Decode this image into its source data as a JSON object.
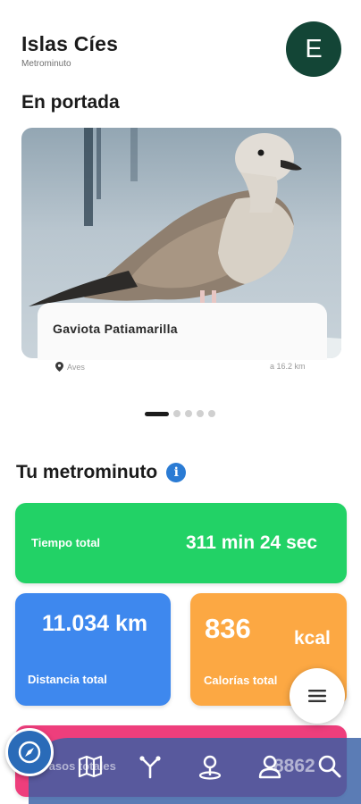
{
  "header": {
    "title": "Islas Cíes",
    "subtitle": "Metrominuto",
    "avatar_initial": "E"
  },
  "featured": {
    "section_title": "En portada",
    "item_name": "Gaviota Patiamarilla",
    "category": "Aves",
    "distance": "a 16.2 km",
    "carousel_total": 5,
    "carousel_active": 1
  },
  "metrominuto": {
    "title": "Tu metrominuto",
    "time": {
      "label": "Tiempo total",
      "value": "311 min 24 sec"
    },
    "distance": {
      "label": "Distancia total",
      "value": "11.034 km"
    },
    "calories": {
      "label": "Calorías total",
      "value": "836",
      "unit": "kcal"
    },
    "steps": {
      "label": "Pasos totales",
      "value": "8862"
    }
  },
  "nav": {
    "items": [
      "compass-icon",
      "map-icon",
      "route-icon",
      "location-pin-icon",
      "user-icon",
      "search-icon",
      "menu-icon"
    ]
  },
  "colors": {
    "avatar": "#134536",
    "time_card": "#22d266",
    "distance_card": "#3e88ee",
    "calories_card": "#fca843",
    "steps_card": "#ee3e7c",
    "nav_bar": "#375fa5",
    "info": "#2a7bd4"
  }
}
